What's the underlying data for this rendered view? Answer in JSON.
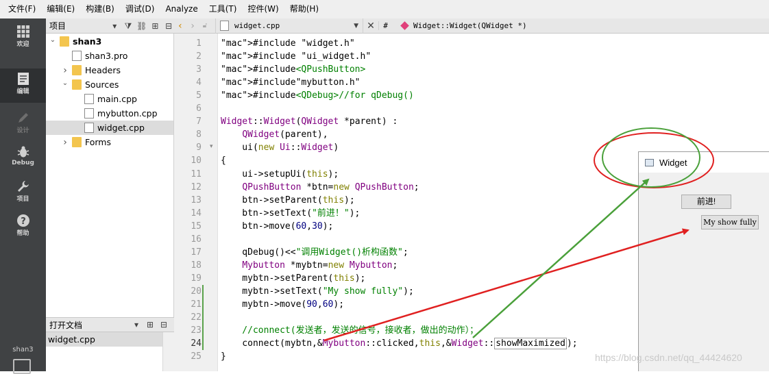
{
  "menu": [
    "文件(F)",
    "编辑(E)",
    "构建(B)",
    "调试(D)",
    "Analyze",
    "工具(T)",
    "控件(W)",
    "帮助(H)"
  ],
  "modes": [
    {
      "label": "欢迎",
      "icon": "grid-icon"
    },
    {
      "label": "编辑",
      "icon": "edit-document-icon"
    },
    {
      "label": "设计",
      "icon": "pencil-icon"
    },
    {
      "label": "Debug",
      "icon": "bug-icon"
    },
    {
      "label": "项目",
      "icon": "wrench-icon"
    },
    {
      "label": "帮助",
      "icon": "help-icon"
    }
  ],
  "kit_label": "shan3",
  "project_panel": {
    "title": "项目",
    "tree": [
      {
        "label": "shan3",
        "level": 0,
        "bold": true,
        "expanded": true,
        "type": "project-folder"
      },
      {
        "label": "shan3.pro",
        "level": 1,
        "type": "pro-file"
      },
      {
        "label": "Headers",
        "level": 1,
        "expanded": false,
        "type": "folder",
        "badge": "h"
      },
      {
        "label": "Sources",
        "level": 1,
        "expanded": true,
        "type": "folder",
        "badge": "C++"
      },
      {
        "label": "main.cpp",
        "level": 2,
        "type": "cpp-file"
      },
      {
        "label": "mybutton.cpp",
        "level": 2,
        "type": "cpp-file"
      },
      {
        "label": "widget.cpp",
        "level": 2,
        "type": "cpp-file",
        "selected": true
      },
      {
        "label": "Forms",
        "level": 1,
        "expanded": false,
        "type": "forms-folder"
      }
    ]
  },
  "open_docs": {
    "title": "打开文档",
    "items": [
      "widget.cpp"
    ]
  },
  "editor_toolbar": {
    "file": "widget.cpp",
    "hash": "#",
    "symbol": "Widget::Widget(QWidget *)"
  },
  "code_lines": [
    {
      "n": "1",
      "t": "#include \"widget.h\""
    },
    {
      "n": "2",
      "t": "#include \"ui_widget.h\""
    },
    {
      "n": "3",
      "t": "#include<QPushButton>"
    },
    {
      "n": "4",
      "t": "#include\"mybutton.h\""
    },
    {
      "n": "5",
      "t": "#include<QDebug>//for qDebug()"
    },
    {
      "n": "6",
      "t": ""
    },
    {
      "n": "7",
      "t": "Widget::Widget(QWidget *parent) :"
    },
    {
      "n": "8",
      "t": "    QWidget(parent),"
    },
    {
      "n": "9",
      "t": "    ui(new Ui::Widget)"
    },
    {
      "n": "10",
      "t": "{"
    },
    {
      "n": "11",
      "t": "    ui->setupUi(this);"
    },
    {
      "n": "12",
      "t": "    QPushButton *btn=new QPushButton;"
    },
    {
      "n": "13",
      "t": "    btn->setParent(this);"
    },
    {
      "n": "14",
      "t": "    btn->setText(\"前进！\");"
    },
    {
      "n": "15",
      "t": "    btn->move(60,30);"
    },
    {
      "n": "16",
      "t": ""
    },
    {
      "n": "17",
      "t": "    qDebug()<<\"调用Widget()析构函数\";"
    },
    {
      "n": "18",
      "t": "    Mybutton *mybtn=new Mybutton;"
    },
    {
      "n": "19",
      "t": "    mybtn->setParent(this);"
    },
    {
      "n": "20",
      "t": "    mybtn->setText(\"My show fully\");"
    },
    {
      "n": "21",
      "t": "    mybtn->move(90,60);"
    },
    {
      "n": "22",
      "t": ""
    },
    {
      "n": "23",
      "t": "    //connect(发送者，发送的信号，接收者，做出的动作）；"
    },
    {
      "n": "24",
      "t": "    connect(mybtn,&Mybutton::clicked,this,&Widget::showMaximized);"
    },
    {
      "n": "25",
      "t": "}"
    }
  ],
  "widget_window": {
    "title": "Widget",
    "button_forward": "前进!",
    "button_mybtn": "My show fully"
  },
  "annotations": {
    "red_color": "#e02020",
    "green_color": "#4aa03a"
  },
  "watermark": "https://blog.csdn.net/qq_44424620"
}
